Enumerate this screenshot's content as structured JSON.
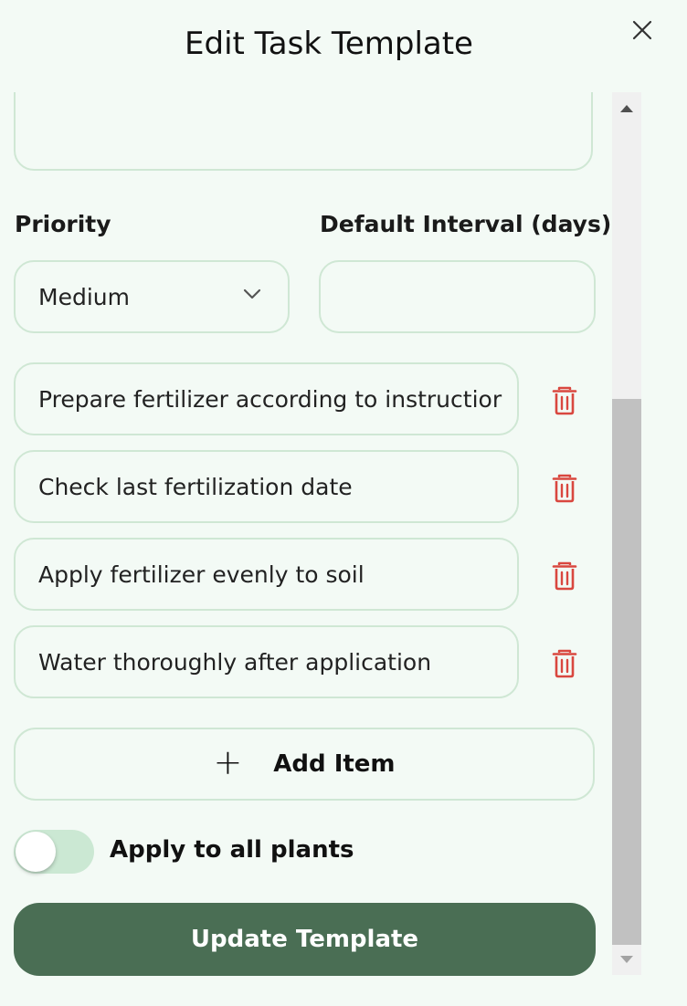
{
  "header": {
    "title": "Edit Task Template",
    "close_icon": "close-icon"
  },
  "form": {
    "notes": {
      "value": ""
    },
    "priority": {
      "label": "Priority",
      "value": "Medium"
    },
    "interval": {
      "label": "Default Interval (days)",
      "value": ""
    },
    "checklist": [
      {
        "text": "Prepare fertilizer according to instructior"
      },
      {
        "text": "Check last fertilization date"
      },
      {
        "text": "Apply fertilizer evenly to soil"
      },
      {
        "text": "Water thoroughly after application"
      }
    ],
    "add_item_label": "Add Item",
    "apply_all": {
      "label": "Apply to all plants",
      "enabled": false
    },
    "submit_label": "Update Template"
  },
  "colors": {
    "background": "#f3faf5",
    "border": "#cfe7d4",
    "primary": "#4a6e54",
    "delete": "#d9473f",
    "toggle_track": "#cbe8d3"
  }
}
